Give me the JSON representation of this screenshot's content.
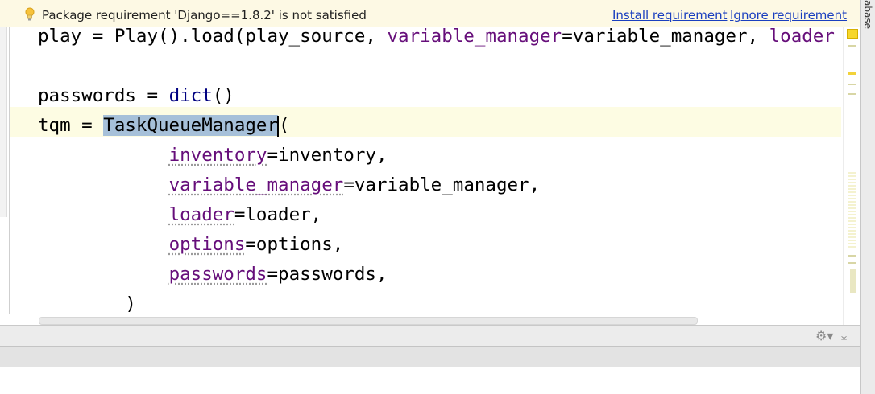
{
  "notification": {
    "message": "Package requirement 'Django==1.8.2' is not satisfied",
    "install_link": "Install requirement",
    "ignore_link": "Ignore requirement"
  },
  "editor": {
    "lines": [
      {
        "indent": "",
        "segments": [
          {
            "t": "play = Play().load(play_source, ",
            "c": ""
          },
          {
            "t": "variable_manager",
            "c": "p"
          },
          {
            "t": "=variable_manager, ",
            "c": ""
          },
          {
            "t": "loader",
            "c": "p"
          }
        ]
      },
      {
        "indent": "",
        "segments": []
      },
      {
        "indent": "",
        "segments": [
          {
            "t": "passwords = ",
            "c": ""
          },
          {
            "t": "dict",
            "c": "b"
          },
          {
            "t": "()",
            "c": ""
          }
        ]
      },
      {
        "indent": "",
        "segments": [
          {
            "t": "tqm = ",
            "c": ""
          },
          {
            "t": "TaskQueueManager",
            "c": "sel"
          },
          {
            "t": "|",
            "c": "cursor"
          },
          {
            "t": "(",
            "c": ""
          }
        ]
      },
      {
        "indent": "            ",
        "segments": [
          {
            "t": "inventory",
            "c": "p squig"
          },
          {
            "t": "=inventory,",
            "c": ""
          }
        ]
      },
      {
        "indent": "            ",
        "segments": [
          {
            "t": "variable_manager",
            "c": "p squig"
          },
          {
            "t": "=variable_manager,",
            "c": ""
          }
        ]
      },
      {
        "indent": "            ",
        "segments": [
          {
            "t": "loader",
            "c": "p squig"
          },
          {
            "t": "=loader,",
            "c": ""
          }
        ]
      },
      {
        "indent": "            ",
        "segments": [
          {
            "t": "options",
            "c": "p squig"
          },
          {
            "t": "=options,",
            "c": ""
          }
        ]
      },
      {
        "indent": "            ",
        "segments": [
          {
            "t": "passwords",
            "c": "p squig"
          },
          {
            "t": "=passwords,",
            "c": ""
          }
        ]
      },
      {
        "indent": "        ",
        "segments": [
          {
            "t": ")",
            "c": ""
          }
        ]
      }
    ]
  },
  "right_tab": "abase",
  "icons": {
    "bulb": "lightbulb-icon",
    "settings": "gear-icon",
    "pin": "download-icon"
  },
  "colors": {
    "param": "#660e7a",
    "builtin": "#000080",
    "selection": "#a6c0d9",
    "link": "#1a3fbf",
    "notification_bg": "#fdf9e4",
    "caret_row": "#fdfce3"
  }
}
